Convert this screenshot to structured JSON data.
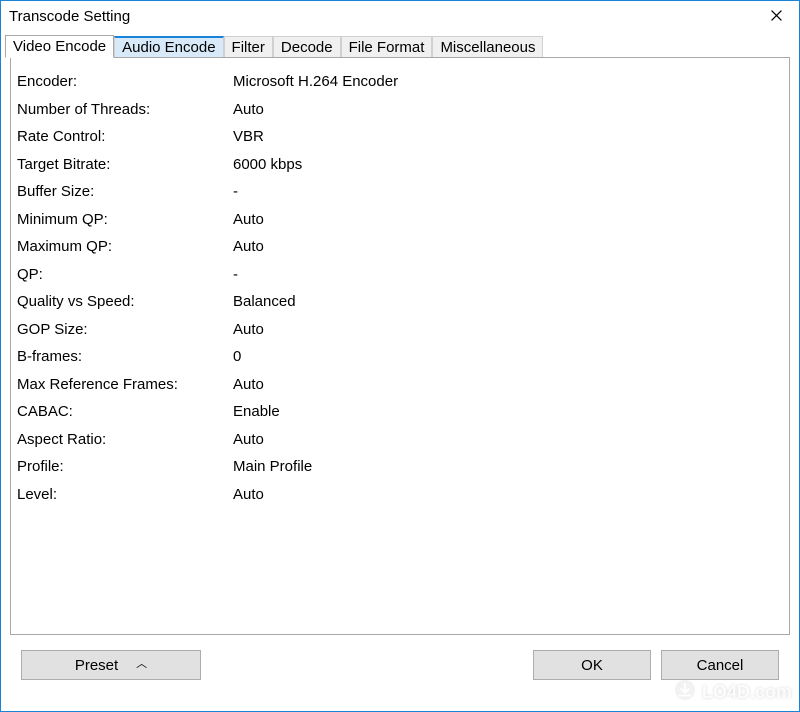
{
  "window": {
    "title": "Transcode Setting"
  },
  "tabs": [
    {
      "label": "Video Encode",
      "active": true
    },
    {
      "label": "Audio Encode",
      "hover": true
    },
    {
      "label": "Filter"
    },
    {
      "label": "Decode"
    },
    {
      "label": "File Format"
    },
    {
      "label": "Miscellaneous"
    }
  ],
  "settings": [
    {
      "label": "Encoder:",
      "value": "Microsoft H.264 Encoder"
    },
    {
      "label": "Number of Threads:",
      "value": "Auto"
    },
    {
      "label": "Rate Control:",
      "value": "VBR"
    },
    {
      "label": "Target Bitrate:",
      "value": "6000 kbps"
    },
    {
      "label": "Buffer Size:",
      "value": "-"
    },
    {
      "label": "Minimum QP:",
      "value": "Auto"
    },
    {
      "label": "Maximum QP:",
      "value": "Auto"
    },
    {
      "label": "QP:",
      "value": "-"
    },
    {
      "label": "Quality vs Speed:",
      "value": "Balanced"
    },
    {
      "label": "GOP Size:",
      "value": "Auto"
    },
    {
      "label": "B-frames:",
      "value": "0"
    },
    {
      "label": "Max Reference Frames:",
      "value": "Auto"
    },
    {
      "label": "CABAC:",
      "value": "Enable"
    },
    {
      "label": "Aspect Ratio:",
      "value": "Auto"
    },
    {
      "label": "Profile:",
      "value": "Main Profile"
    },
    {
      "label": "Level:",
      "value": "Auto"
    }
  ],
  "buttons": {
    "preset": "Preset",
    "ok": "OK",
    "cancel": "Cancel"
  },
  "watermark": "LO4D.com"
}
